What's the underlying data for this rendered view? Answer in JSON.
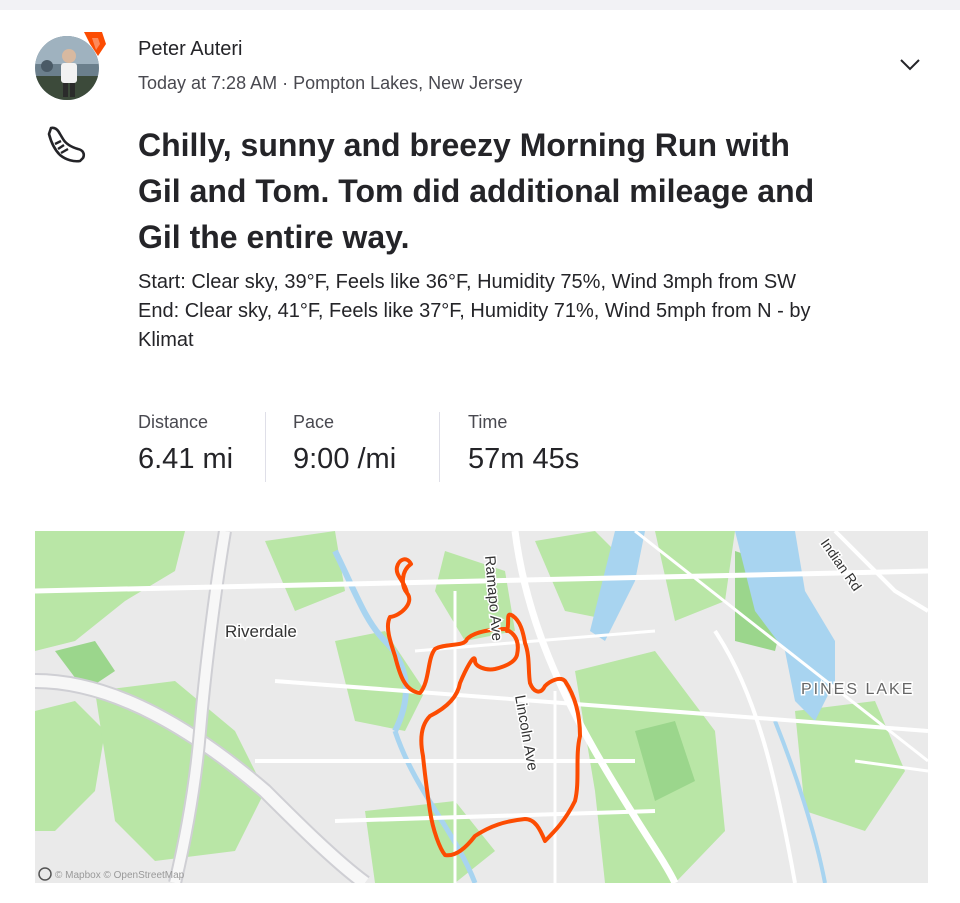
{
  "post": {
    "athlete_name": "Peter Auteri",
    "meta": "Today at 7:28 AM · Pompton Lakes, New Jersey",
    "activity_icon": "running-shoe-icon",
    "title": "Chilly, sunny and breezy Morning Run with Gil and Tom. Tom did additional mileage and Gil the entire way.",
    "description": [
      "Start: Clear sky, 39°F, Feels like 36°F, Humidity 75%, Wind 3mph from SW",
      "End: Clear sky, 41°F, Feels like 37°F, Humidity 71%, Wind 5mph from N - by Klimat"
    ]
  },
  "stats": [
    {
      "label": "Distance",
      "value": "6.41 mi"
    },
    {
      "label": "Pace",
      "value": "9:00 /mi"
    },
    {
      "label": "Time",
      "value": "57m 45s"
    }
  ],
  "map": {
    "labels": {
      "riverdale": "Riverdale",
      "ramapo": "Ramapo Ave",
      "lincoln": "Lincoln Ave",
      "indian": "Indian Rd",
      "pines": "PINES LAKE"
    },
    "attribution": "© Mapbox © OpenStreetMap"
  },
  "colors": {
    "route": "#fc4c02",
    "water": "#a8d4f0",
    "park": "#b9e6a6",
    "badge": "#fc4c02"
  }
}
